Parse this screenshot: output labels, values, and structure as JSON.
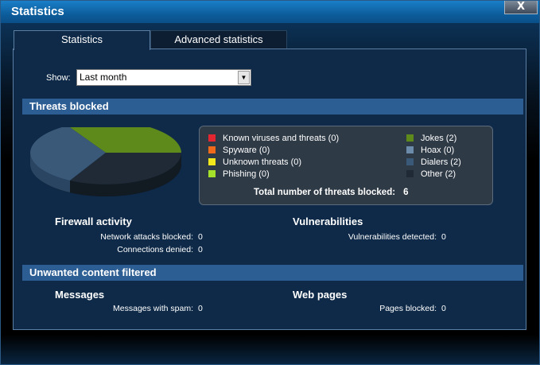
{
  "window": {
    "title": "Statistics",
    "close_label": "X"
  },
  "tabs": [
    {
      "label": "Statistics",
      "active": true
    },
    {
      "label": "Advanced statistics",
      "active": false
    }
  ],
  "filter": {
    "label": "Show:",
    "value": "Last month",
    "arrow": "▼"
  },
  "threats": {
    "header": "Threats blocked",
    "legend_left": [
      {
        "label": "Known viruses and threats (0)",
        "color": "#e3262f"
      },
      {
        "label": "Spyware (0)",
        "color": "#f06a1c"
      },
      {
        "label": "Unknown threats (0)",
        "color": "#f2e81c"
      },
      {
        "label": "Phishing (0)",
        "color": "#a5e02a"
      }
    ],
    "legend_right": [
      {
        "label": "Jokes (2)",
        "color": "#5e8a1c"
      },
      {
        "label": "Hoax (0)",
        "color": "#6c8aaa"
      },
      {
        "label": "Dialers (2)",
        "color": "#3a5878"
      },
      {
        "label": "Other (2)",
        "color": "#1f2a36"
      }
    ],
    "total_label": "Total number of threats blocked:",
    "total_value": "6",
    "pie": [
      {
        "name": "Jokes",
        "value": 2,
        "color": "#5e8a1c"
      },
      {
        "name": "Dialers",
        "value": 2,
        "color": "#3a5878"
      },
      {
        "name": "Other",
        "value": 2,
        "color": "#1f2a36"
      }
    ]
  },
  "firewall": {
    "title": "Firewall activity",
    "rows": [
      {
        "label": "Network attacks blocked:",
        "value": "0"
      },
      {
        "label": "Connections denied:",
        "value": "0"
      }
    ]
  },
  "vulnerabilities": {
    "title": "Vulnerabilities",
    "rows": [
      {
        "label": "Vulnerabilities detected:",
        "value": "0"
      }
    ]
  },
  "unwanted": {
    "header": "Unwanted content filtered",
    "messages": {
      "title": "Messages",
      "row_label": "Messages with spam:",
      "row_value": "0"
    },
    "web": {
      "title": "Web pages",
      "row_label": "Pages blocked:",
      "row_value": "0"
    }
  }
}
